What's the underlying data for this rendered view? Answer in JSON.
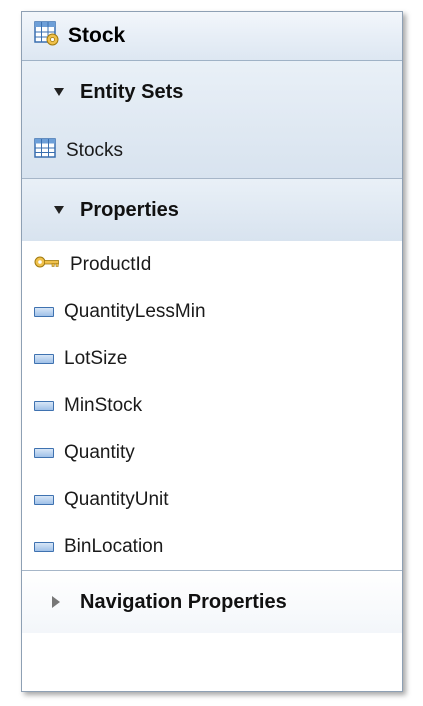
{
  "entity": {
    "title": "Stock",
    "icon": "entity-table-gear-icon"
  },
  "entity_sets": {
    "label": "Entity Sets",
    "expanded": true,
    "items": [
      {
        "label": "Stocks",
        "icon": "entity-set-grid-icon"
      }
    ]
  },
  "properties": {
    "label": "Properties",
    "expanded": true,
    "items": [
      {
        "label": "ProductId",
        "icon": "key-icon"
      },
      {
        "label": "QuantityLessMin",
        "icon": "property-icon"
      },
      {
        "label": "LotSize",
        "icon": "property-icon"
      },
      {
        "label": "MinStock",
        "icon": "property-icon"
      },
      {
        "label": "Quantity",
        "icon": "property-icon"
      },
      {
        "label": "QuantityUnit",
        "icon": "property-icon"
      },
      {
        "label": "BinLocation",
        "icon": "property-icon"
      }
    ]
  },
  "navigation_properties": {
    "label": "Navigation Properties",
    "expanded": false
  },
  "colors": {
    "border": "#8ea0b4",
    "section_bg": "#dde7f2",
    "property_icon": "#3f72b0",
    "key_icon": "#d4a017"
  }
}
